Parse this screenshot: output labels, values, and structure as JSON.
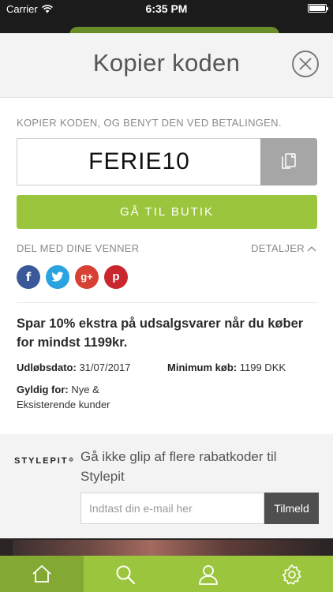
{
  "status_bar": {
    "carrier": "Carrier",
    "time": "6:35 PM",
    "battery_level": 1.0
  },
  "modal": {
    "title": "Kopier koden",
    "instruction": "KOPIER KODEN, OG BENYT DEN VED BETALINGEN.",
    "coupon_code": "FERIE10",
    "go_button": "GÅ TIL BUTIK",
    "share_label": "DEL MED DINE VENNER",
    "details_link": "DETALJER",
    "social": {
      "facebook": "f",
      "twitter": "t",
      "google_plus": "g+",
      "pinterest": "p"
    },
    "offer": {
      "title": "Spar 10% ekstra på udsalgsvarer når du køber for mindst 1199kr.",
      "expiry_label": "Udløbsdato:",
      "expiry_value": "31/07/2017",
      "min_label": "Minimum køb:",
      "min_value": "1199 DKK",
      "valid_label": "Gyldig for:",
      "valid_value": "Nye & Eksisterende kunder"
    }
  },
  "newsletter": {
    "brand": "STYLEPIT",
    "text": "Gå ikke glip af flere rabatkoder til Stylepit",
    "email_placeholder": "Indtast din e-mail her",
    "signup_button": "Tilmeld"
  },
  "tab_bar": {
    "tabs": [
      {
        "icon": "home-icon",
        "active": true
      },
      {
        "icon": "search-icon",
        "active": false
      },
      {
        "icon": "user-icon",
        "active": false
      },
      {
        "icon": "gear-icon",
        "active": false
      }
    ]
  },
  "colors": {
    "accent_green": "#9cc53e",
    "active_tab_green": "#83a932",
    "copy_button_gray": "#a6a6a6",
    "facebook": "#3b5998",
    "twitter": "#2aa3e0",
    "google_plus": "#d64134",
    "pinterest": "#c9272d"
  }
}
